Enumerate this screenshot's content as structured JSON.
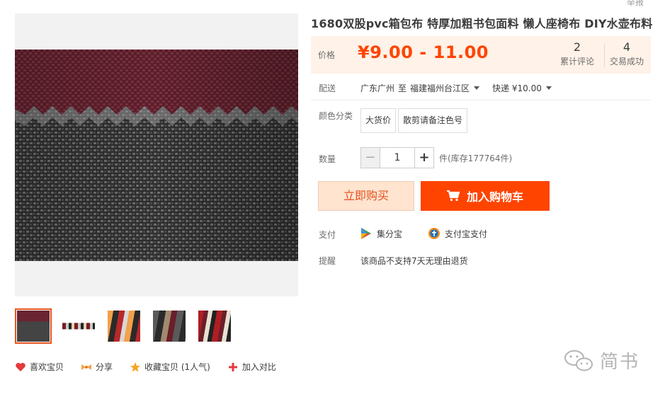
{
  "header": {
    "report_label": "举报"
  },
  "product": {
    "title": "1680双股pvc箱包布 特厚加粗书包面料 懒人座椅布 DIY水壶布料",
    "price_label": "价格",
    "price": "¥9.00 - 11.00",
    "reviews_count": "2",
    "reviews_label": "累计评论",
    "sales_count": "4",
    "sales_label": "交易成功",
    "shipping_label": "配送",
    "ship_from": "广东广州",
    "ship_to_word": "至",
    "ship_to": "福建福州台江区",
    "express": "快递 ¥10.00",
    "color_label": "颜色分类",
    "sku_options": [
      "大货价",
      "散剪请备注色号"
    ],
    "qty_label": "数量",
    "qty_minus": "−",
    "qty_value": "1",
    "qty_plus": "+",
    "stock_text": "件(库存177764件)",
    "buy_now": "立即购买",
    "add_to_cart": "加入购物车",
    "pay_label": "支付",
    "pay_methods": [
      "集分宝",
      "支付宝支付"
    ],
    "notice_label": "提醒",
    "notice_text": "该商品不支持7天无理由退货"
  },
  "actions": {
    "like": "喜欢宝贝",
    "share": "分享",
    "favorite": "收藏宝贝 (1人气)",
    "compare": "加入对比"
  },
  "watermark": {
    "text": "简书"
  },
  "colors": {
    "accent": "#ff4400",
    "price_bg": "#fff2e8",
    "buy_bg": "#ffe4d0",
    "active_thumb_border": "#e8541e"
  },
  "icons": [
    "heart-icon",
    "share-icon",
    "star-icon",
    "plus-icon",
    "cart-icon",
    "jifenbao-icon",
    "alipay-icon",
    "wechat-icon"
  ]
}
